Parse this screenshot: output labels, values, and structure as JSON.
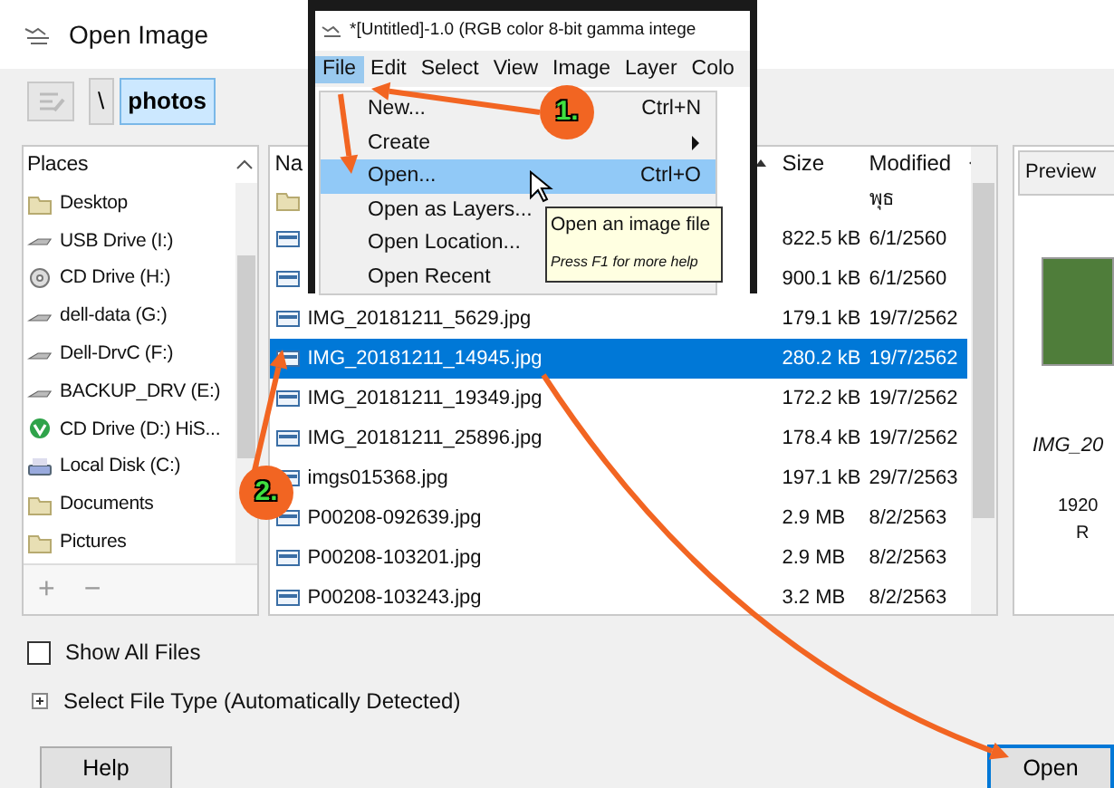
{
  "dialog": {
    "title": "Open Image",
    "path_buttons": [
      {
        "label": "\\",
        "selected": false
      },
      {
        "label": "photos",
        "selected": true
      }
    ],
    "places": {
      "header": "Places",
      "items": [
        {
          "label": "Desktop",
          "kind": "folder"
        },
        {
          "label": "USB Drive (I:)",
          "kind": "drive"
        },
        {
          "label": "CD Drive (H:)",
          "kind": "cd"
        },
        {
          "label": "dell-data (G:)",
          "kind": "drive"
        },
        {
          "label": "Dell-DrvC (F:)",
          "kind": "drive"
        },
        {
          "label": "BACKUP_DRV (E:)",
          "kind": "drive"
        },
        {
          "label": "CD Drive (D:) HiS...",
          "kind": "app"
        },
        {
          "label": "Local Disk (C:)",
          "kind": "disk"
        },
        {
          "label": "Documents",
          "kind": "folder"
        },
        {
          "label": "Pictures",
          "kind": "folder"
        }
      ],
      "buttons": [
        "+",
        "−"
      ]
    },
    "files": {
      "columns": [
        "Na",
        "Size",
        "Modified"
      ],
      "rows": [
        {
          "kind": "folder",
          "modified": "พุธ",
          "selected": false
        },
        {
          "kind": "image",
          "size": "822.5 kB",
          "modified": "6/1/2560",
          "selected": false
        },
        {
          "kind": "image",
          "size": "900.1 kB",
          "modified": "6/1/2560",
          "selected": false
        },
        {
          "kind": "image",
          "name": "IMG_20181211_5629.jpg",
          "size": "179.1 kB",
          "modified": "19/7/2562",
          "selected": false
        },
        {
          "kind": "image",
          "name": "IMG_20181211_14945.jpg",
          "size": "280.2 kB",
          "modified": "19/7/2562",
          "selected": true
        },
        {
          "kind": "image",
          "name": "IMG_20181211_19349.jpg",
          "size": "172.2 kB",
          "modified": "19/7/2562",
          "selected": false
        },
        {
          "kind": "image",
          "name": "IMG_20181211_25896.jpg",
          "size": "178.4 kB",
          "modified": "19/7/2562",
          "selected": false
        },
        {
          "kind": "image",
          "name": "imgs015368.jpg",
          "size": "197.1 kB",
          "modified": "29/7/2563",
          "selected": false
        },
        {
          "kind": "image",
          "name": "P00208-092639.jpg",
          "size": "2.9 MB",
          "modified": "8/2/2563",
          "selected": false
        },
        {
          "kind": "image",
          "name": "P00208-103201.jpg",
          "size": "2.9 MB",
          "modified": "8/2/2563",
          "selected": false
        },
        {
          "kind": "image",
          "name": "P00208-103243.jpg",
          "size": "3.2 MB",
          "modified": "8/2/2563",
          "selected": false
        }
      ]
    },
    "preview": {
      "tab": "Preview",
      "filename": "IMG_20",
      "details": [
        "1920",
        "R"
      ]
    },
    "show_all_files": {
      "label": "Show All Files",
      "checked": false
    },
    "file_type": {
      "label": "Select File Type (Automatically Detected)",
      "expanded": false
    },
    "buttons": [
      {
        "label": "Help",
        "kind": "plain"
      },
      {
        "label": "Open",
        "kind": "default"
      }
    ]
  },
  "gimp_window": {
    "title": "*[Untitled]-1.0 (RGB color 8-bit gamma intege",
    "menubar": [
      {
        "label": "File",
        "selected": true
      },
      {
        "label": "Edit",
        "selected": false
      },
      {
        "label": "Select",
        "selected": false
      },
      {
        "label": "View",
        "selected": false
      },
      {
        "label": "Image",
        "selected": false
      },
      {
        "label": "Layer",
        "selected": false
      },
      {
        "label": "Colo",
        "selected": false
      }
    ],
    "menu": [
      {
        "label": "New...",
        "shortcut": "Ctrl+N",
        "selected": false
      },
      {
        "label": "Create",
        "submenu": true,
        "selected": false
      },
      {
        "label": "Open...",
        "shortcut": "Ctrl+O",
        "selected": true
      },
      {
        "label": "Open as Layers...",
        "selected": false
      },
      {
        "label": "Open Location...",
        "selected": false
      },
      {
        "label": "Open Recent",
        "selected": false
      }
    ],
    "tooltip": {
      "text": "Open an image file",
      "hint": "Press F1 for more help"
    }
  },
  "annotations": {
    "steps": [
      "1.",
      "2."
    ]
  }
}
